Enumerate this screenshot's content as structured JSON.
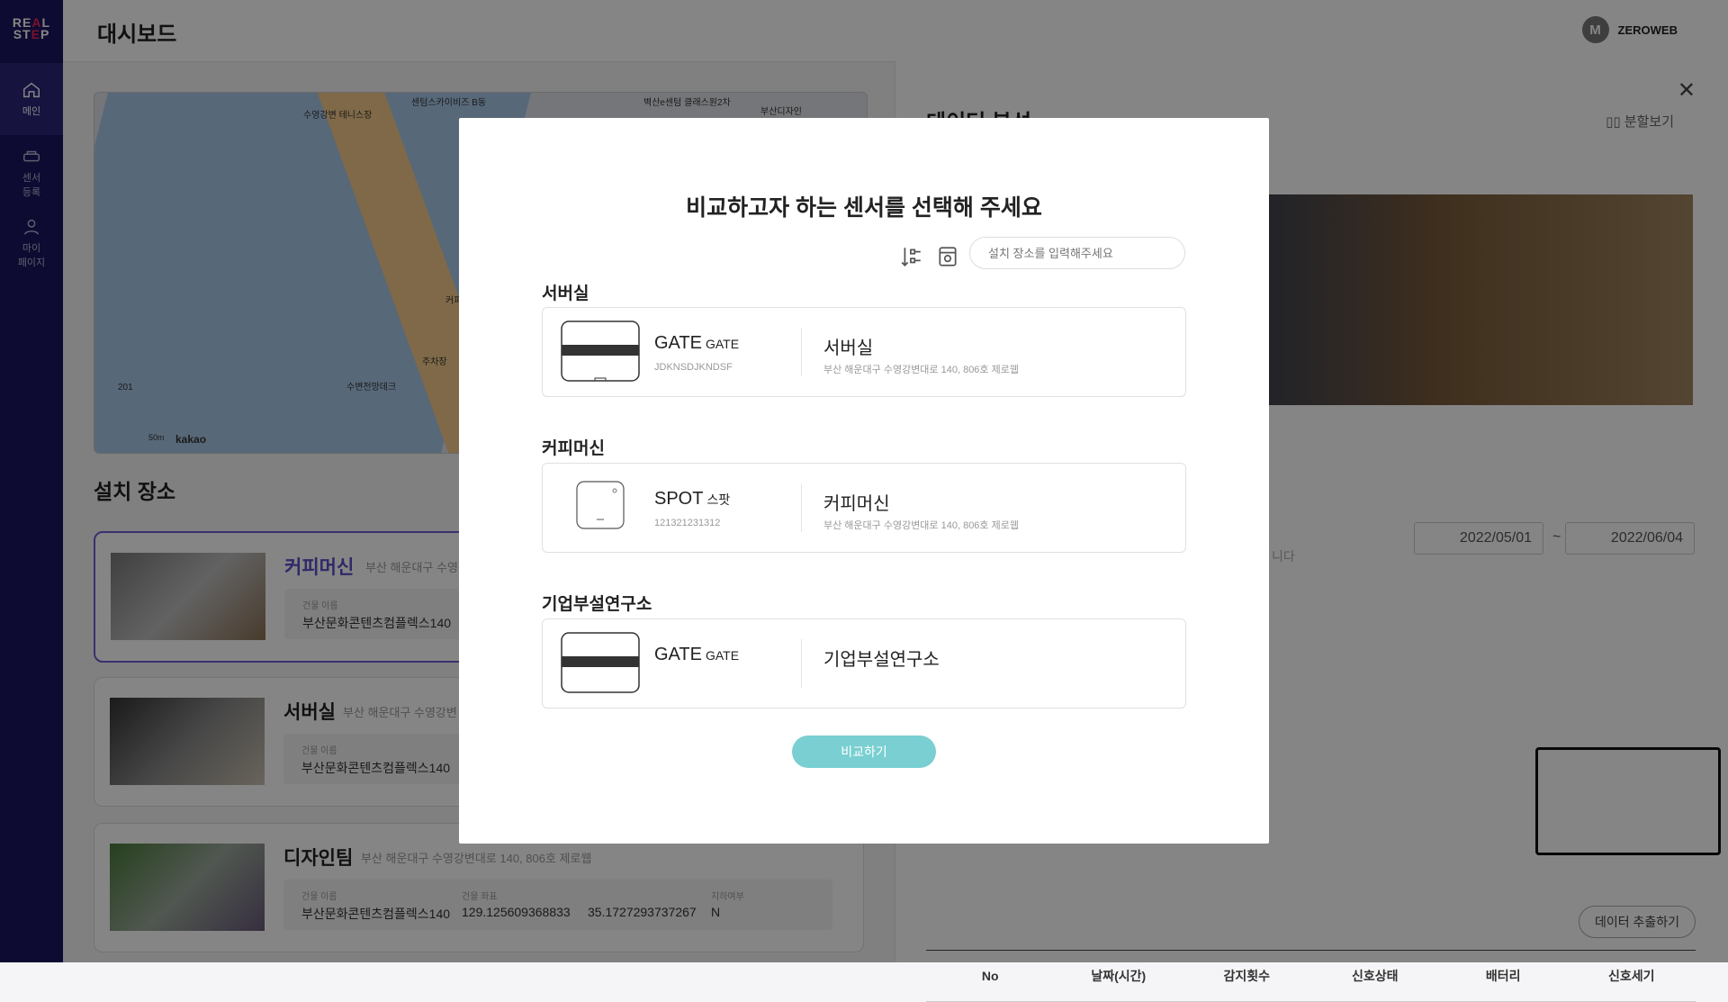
{
  "sidebar": {
    "logo": "REAL STEP",
    "items": [
      {
        "label": "메인",
        "icon": "home-icon"
      },
      {
        "label": "센서\n등록",
        "icon": "sensor-icon"
      },
      {
        "label": "마이\n페이지",
        "icon": "user-icon"
      }
    ]
  },
  "header": {
    "title": "대시보드",
    "avatar_initial": "M",
    "username": "ZEROWEB"
  },
  "map": {
    "labels": [
      "수영강변 테니스장",
      "센텀스카이비즈 B동",
      "벽산e센텀 클래스원2차",
      "부산디자인",
      "커피",
      "주차장",
      "수변전망데크",
      "201"
    ],
    "brand": "kakao",
    "scale": "50m"
  },
  "places": {
    "title": "설치 장소",
    "items": [
      {
        "name": "커피머신",
        "address": "부산 해운대구 수영강",
        "building_label": "건물 이름",
        "building": "부산문화콘텐츠컴플렉스140"
      },
      {
        "name": "서버실",
        "address": "부산 해운대구 수영강변",
        "building_label": "건물 이름",
        "building": "부산문화콘텐츠컴플렉스140"
      },
      {
        "name": "디자인팀",
        "address": "부산 해운대구 수영강변대로 140, 806호 제로웹",
        "building_label": "건물 이름",
        "building": "부산문화콘텐츠컴플렉스140",
        "coord_label": "건물 좌표",
        "coord_x": "129.125609368833",
        "coord_y": "35.1727293737267",
        "basement_label": "지하여부",
        "basement": "N"
      }
    ]
  },
  "right_panel": {
    "title": "데이터 분석",
    "split_view": "분할보기",
    "hint": "니다",
    "date_from": "2022/05/01",
    "date_sep": "~",
    "date_to": "2022/06/04",
    "export": "데이터 추출하기",
    "columns": [
      "No",
      "날짜(시간)",
      "감지횟수",
      "신호상태",
      "배터리",
      "신호세기"
    ]
  },
  "modal": {
    "title": "비교하고자 하는 센서를 선택해 주세요",
    "search_placeholder": "설치 장소를 입력해주세요",
    "groups": [
      {
        "title": "서버실",
        "device": "GATE",
        "type": "GATE",
        "code": "JDKNSDJKNDSF",
        "location": "서버실",
        "address": "부산 해운대구 수영강변대로 140, 806호 제로웹"
      },
      {
        "title": "커피머신",
        "device": "SPOT",
        "type": "스팟",
        "code": "121321231312",
        "location": "커피머신",
        "address": "부산 해운대구 수영강변대로 140, 806호 제로웹"
      },
      {
        "title": "기업부설연구소",
        "device": "GATE",
        "type": "GATE",
        "code": "",
        "location": "기업부설연구소",
        "address": ""
      }
    ],
    "compare_button": "비교하기"
  },
  "colors": {
    "sidebar": "#1c1660",
    "accent": "#6c5fd3",
    "compare_button": "#79cfd1"
  }
}
